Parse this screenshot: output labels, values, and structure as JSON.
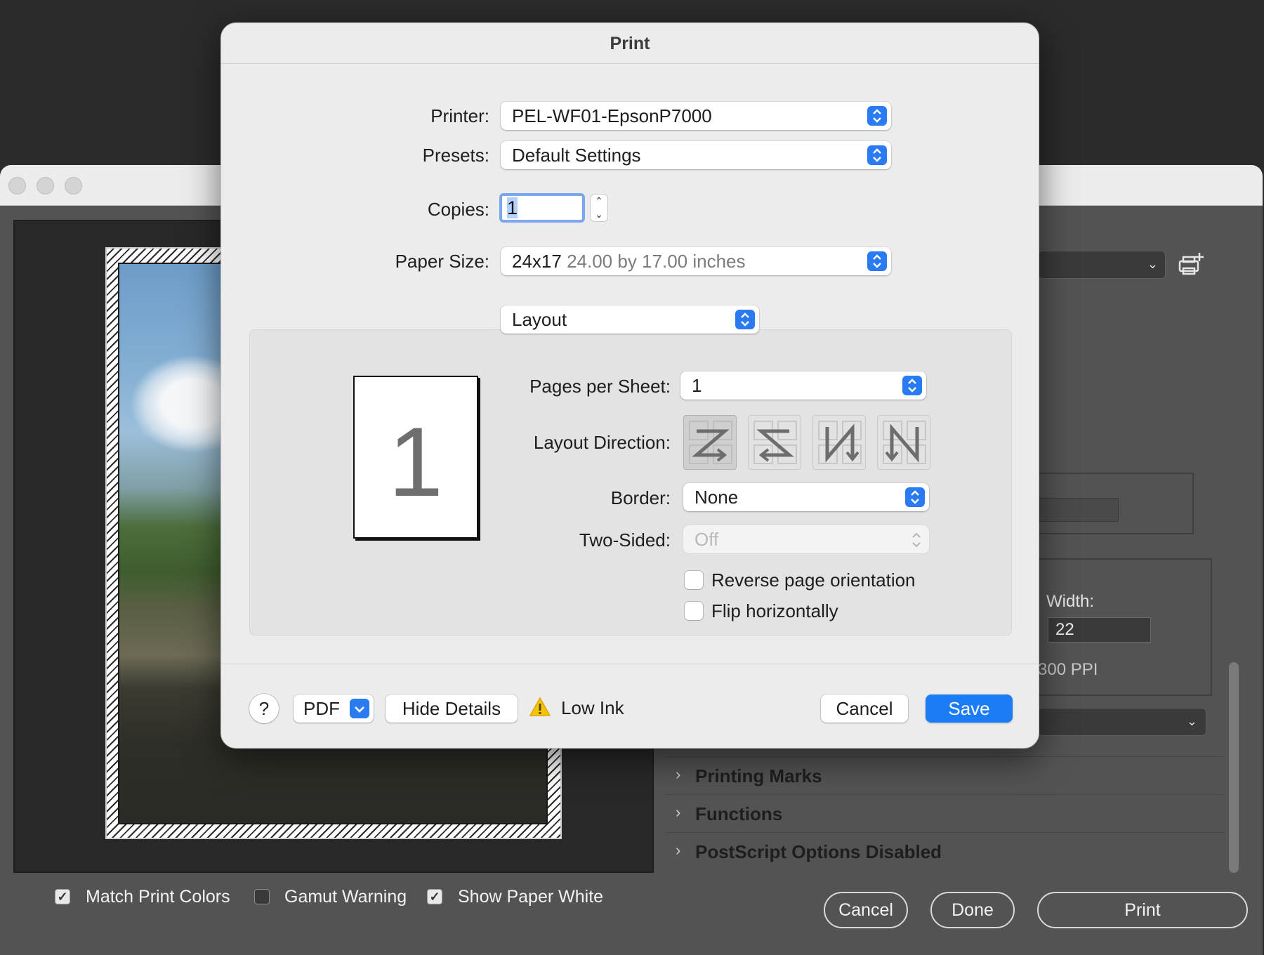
{
  "background_window": {
    "sections": [
      "Printing Marks",
      "Functions",
      "PostScript Options Disabled"
    ],
    "width_label": "Width:",
    "width_value": "22",
    "resolution": "300 PPI",
    "checkboxes": [
      {
        "label": "Match Print Colors",
        "checked": true
      },
      {
        "label": "Gamut Warning",
        "checked": false
      },
      {
        "label": "Show Paper White",
        "checked": true
      }
    ],
    "buttons": {
      "cancel": "Cancel",
      "done": "Done",
      "print": "Print"
    }
  },
  "print_dialog": {
    "title": "Print",
    "printer_label": "Printer:",
    "printer_value": "PEL-WF01-EpsonP7000",
    "presets_label": "Presets:",
    "presets_value": "Default Settings",
    "copies_label": "Copies:",
    "copies_value": "1",
    "paper_size_label": "Paper Size:",
    "paper_size_value": "24x17",
    "paper_size_detail": "24.00 by 17.00 inches",
    "section_popup": "Layout",
    "preview_page_number": "1",
    "pages_per_sheet_label": "Pages per Sheet:",
    "pages_per_sheet_value": "1",
    "layout_direction_label": "Layout Direction:",
    "border_label": "Border:",
    "border_value": "None",
    "two_sided_label": "Two-Sided:",
    "two_sided_value": "Off",
    "reverse_orientation_label": "Reverse page orientation",
    "flip_horizontally_label": "Flip horizontally",
    "help_label": "?",
    "pdf_label": "PDF",
    "hide_details_label": "Hide Details",
    "low_ink_label": "Low Ink",
    "cancel_label": "Cancel",
    "save_label": "Save"
  },
  "colors": {
    "accent": "#1b7cf6",
    "warning": "#f5c400"
  }
}
